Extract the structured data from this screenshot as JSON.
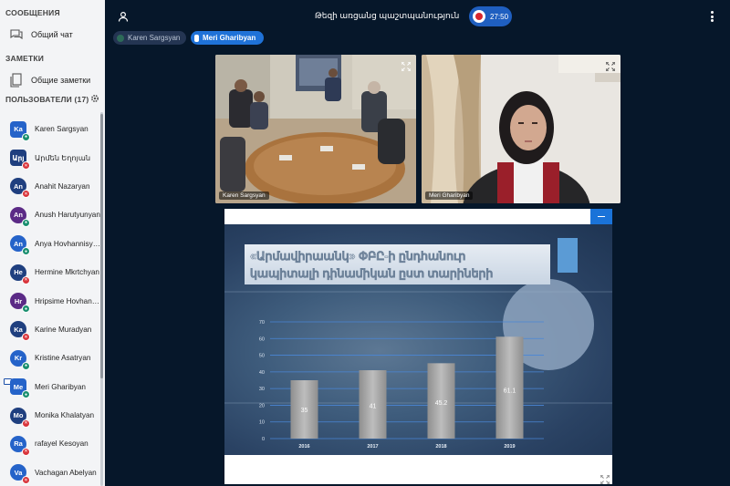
{
  "sidebar": {
    "messages_title": "СООБЩЕНИЯ",
    "public_chat": "Общий чат",
    "notes_title": "ЗАМЕТКИ",
    "shared_notes": "Общие заметки",
    "users_title": "ПОЛЬЗОВАТЕЛИ (17)",
    "users": [
      {
        "initials": "Ka",
        "name": "Karen Sargsyan",
        "color": "#2563c9",
        "status": "mic",
        "round": false,
        "presenter": false
      },
      {
        "initials": "Արյ",
        "name": "Արմեն Եղոյան",
        "color": "#1f3f7f",
        "status": "mute",
        "round": false,
        "presenter": false
      },
      {
        "initials": "An",
        "name": "Anahit Nazaryan",
        "color": "#1f3f7f",
        "status": "mute",
        "round": true,
        "presenter": false
      },
      {
        "initials": "An",
        "name": "Anush Harutyunyan",
        "color": "#5b2a86",
        "status": "mic",
        "round": true,
        "presenter": false
      },
      {
        "initials": "An",
        "name": "Anya Hovhannisyan",
        "color": "#2563c9",
        "status": "mic",
        "round": true,
        "presenter": false
      },
      {
        "initials": "He",
        "name": "Hermine Mkrtchyan",
        "color": "#1f3f7f",
        "status": "mute",
        "round": true,
        "presenter": false
      },
      {
        "initials": "Hr",
        "name": "Hripsime Hovhanni...",
        "color": "#5b2a86",
        "status": "mic",
        "round": true,
        "presenter": false
      },
      {
        "initials": "Ka",
        "name": "Karine Muradyan",
        "color": "#1f3f7f",
        "status": "mute",
        "round": true,
        "presenter": false
      },
      {
        "initials": "Kr",
        "name": "Kristine Asatryan",
        "color": "#2563c9",
        "status": "mic",
        "round": true,
        "presenter": false
      },
      {
        "initials": "Me",
        "name": "Meri Gharibyan",
        "color": "#2563c9",
        "status": "mic",
        "round": false,
        "presenter": true
      },
      {
        "initials": "Mo",
        "name": "Monika Khalatyan",
        "color": "#1f3f7f",
        "status": "mute",
        "round": true,
        "presenter": false
      },
      {
        "initials": "Ra",
        "name": "rafayel Kesoyan",
        "color": "#2563c9",
        "status": "mute",
        "round": true,
        "presenter": false
      },
      {
        "initials": "Va",
        "name": "Vachagan Abelyan",
        "color": "#2563c9",
        "status": "mute",
        "round": true,
        "presenter": false
      }
    ]
  },
  "topbar": {
    "title": "Թեզի առցանց պաշտպանություն",
    "timer": "27:50"
  },
  "talkers": [
    "Karen Sargsyan",
    "Meri Gharibyan"
  ],
  "videos": [
    {
      "label": "Karen Sargsyan"
    },
    {
      "label": "Meri Gharibyan"
    }
  ],
  "slide": {
    "title_line1": "«Արմավիրաանկ» ՓԲԸ-ի ընդհանուր",
    "title_line2": "կապիտալի դինամիկան ըստ տարիների"
  },
  "chart_data": {
    "type": "bar",
    "categories": [
      "2016",
      "2017",
      "2018",
      "2019"
    ],
    "values": [
      35,
      41,
      45.2,
      61.1
    ],
    "value_labels": [
      "35",
      "41",
      "45.2",
      "61.1"
    ],
    "y_ticks": [
      "0",
      "10",
      "20",
      "30",
      "40",
      "50",
      "60",
      "70"
    ],
    "ylim": [
      0,
      70
    ],
    "grid": true
  },
  "colors": {
    "accent": "#1f72d8",
    "recording": "#d7262e",
    "background": "#06172a"
  }
}
